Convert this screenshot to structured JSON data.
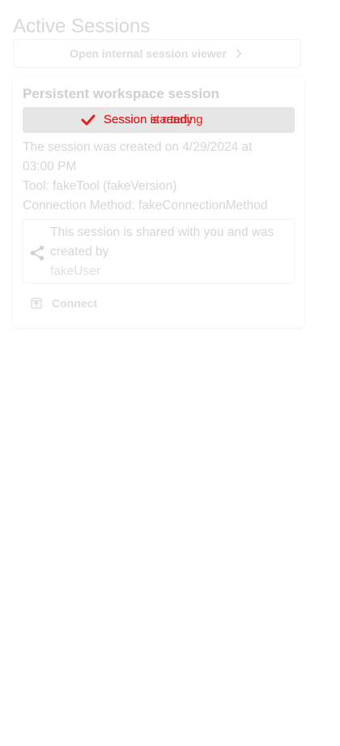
{
  "header": {
    "title": "Active Sessions"
  },
  "viewer_button": {
    "label": "Open internal session viewer",
    "icon": "chevron-right-icon"
  },
  "session_card": {
    "title": "Persistent workspace session",
    "status": {
      "icon": "check-icon",
      "overlapping_labels": [
        "Session is running",
        "Session started",
        "Session is ready"
      ],
      "color": "#e81c1c"
    },
    "created_text": "The session was created on 4/29/2024 at 03:00 PM",
    "tool_text": "Tool: fakeTool (fakeVersion)",
    "connection_text": "Connection Method: fakeConnectionMethod",
    "shared": {
      "icon": "share-icon",
      "text": "This session is shared with you and was created by",
      "user": "fakeUser"
    },
    "connect_button": {
      "label": "Connect",
      "icon": "open-in-new-icon"
    }
  }
}
